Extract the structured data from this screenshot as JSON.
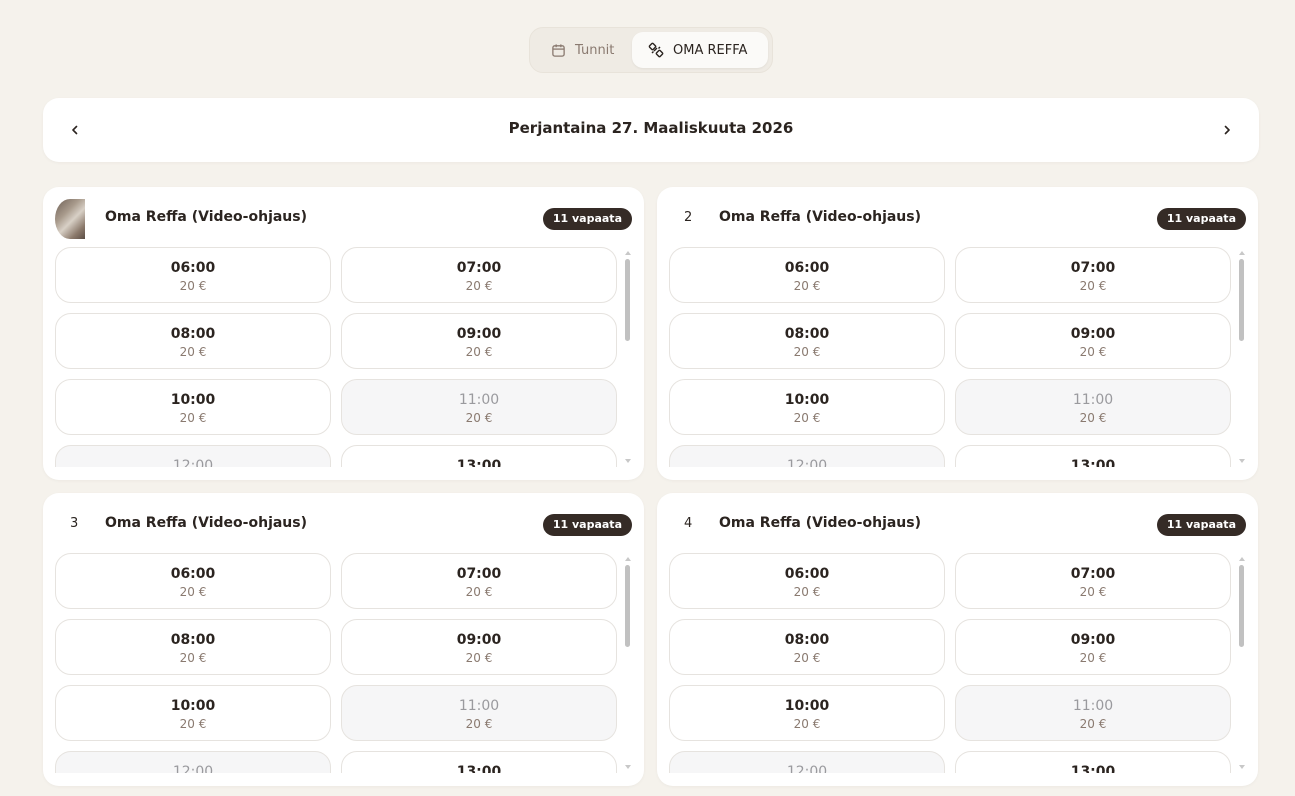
{
  "tabs": [
    {
      "label": "Tunnit",
      "icon": "calendar-icon",
      "active": false
    },
    {
      "label": "OMA REFFA",
      "icon": "video-coaching-icon",
      "active": true
    }
  ],
  "date_bar": {
    "title": "Perjantaina 27. Maaliskuuta 2026"
  },
  "cards": [
    {
      "number": "",
      "has_thumbnail": true,
      "title": "Oma Reffa (Video-ohjaus)",
      "badge": "11 vapaata",
      "slots": [
        {
          "time": "06:00",
          "price": "20 €",
          "booked": false
        },
        {
          "time": "07:00",
          "price": "20 €",
          "booked": false
        },
        {
          "time": "08:00",
          "price": "20 €",
          "booked": false
        },
        {
          "time": "09:00",
          "price": "20 €",
          "booked": false
        },
        {
          "time": "10:00",
          "price": "20 €",
          "booked": false
        },
        {
          "time": "11:00",
          "price": "20 €",
          "booked": true
        },
        {
          "time": "12:00",
          "price": "",
          "booked": true
        },
        {
          "time": "13:00",
          "price": "",
          "booked": false
        }
      ]
    },
    {
      "number": "2",
      "has_thumbnail": false,
      "title": "Oma Reffa (Video-ohjaus)",
      "badge": "11 vapaata",
      "slots": [
        {
          "time": "06:00",
          "price": "20 €",
          "booked": false
        },
        {
          "time": "07:00",
          "price": "20 €",
          "booked": false
        },
        {
          "time": "08:00",
          "price": "20 €",
          "booked": false
        },
        {
          "time": "09:00",
          "price": "20 €",
          "booked": false
        },
        {
          "time": "10:00",
          "price": "20 €",
          "booked": false
        },
        {
          "time": "11:00",
          "price": "20 €",
          "booked": true
        },
        {
          "time": "12:00",
          "price": "",
          "booked": true
        },
        {
          "time": "13:00",
          "price": "",
          "booked": false
        }
      ]
    },
    {
      "number": "3",
      "has_thumbnail": false,
      "title": "Oma Reffa (Video-ohjaus)",
      "badge": "11 vapaata",
      "slots": [
        {
          "time": "06:00",
          "price": "20 €",
          "booked": false
        },
        {
          "time": "07:00",
          "price": "20 €",
          "booked": false
        },
        {
          "time": "08:00",
          "price": "20 €",
          "booked": false
        },
        {
          "time": "09:00",
          "price": "20 €",
          "booked": false
        },
        {
          "time": "10:00",
          "price": "20 €",
          "booked": false
        },
        {
          "time": "11:00",
          "price": "20 €",
          "booked": true
        },
        {
          "time": "12:00",
          "price": "",
          "booked": true
        },
        {
          "time": "13:00",
          "price": "",
          "booked": false
        }
      ]
    },
    {
      "number": "4",
      "has_thumbnail": false,
      "title": "Oma Reffa (Video-ohjaus)",
      "badge": "11 vapaata",
      "slots": [
        {
          "time": "06:00",
          "price": "20 €",
          "booked": false
        },
        {
          "time": "07:00",
          "price": "20 €",
          "booked": false
        },
        {
          "time": "08:00",
          "price": "20 €",
          "booked": false
        },
        {
          "time": "09:00",
          "price": "20 €",
          "booked": false
        },
        {
          "time": "10:00",
          "price": "20 €",
          "booked": false
        },
        {
          "time": "11:00",
          "price": "20 €",
          "booked": true
        },
        {
          "time": "12:00",
          "price": "",
          "booked": true
        },
        {
          "time": "13:00",
          "price": "",
          "booked": false
        }
      ]
    }
  ],
  "colors": {
    "background": "#f5f2ec",
    "text": "#2b2420",
    "muted": "#8a7a70",
    "badge_bg": "#352b26",
    "booked_bg": "#f6f6f7"
  }
}
